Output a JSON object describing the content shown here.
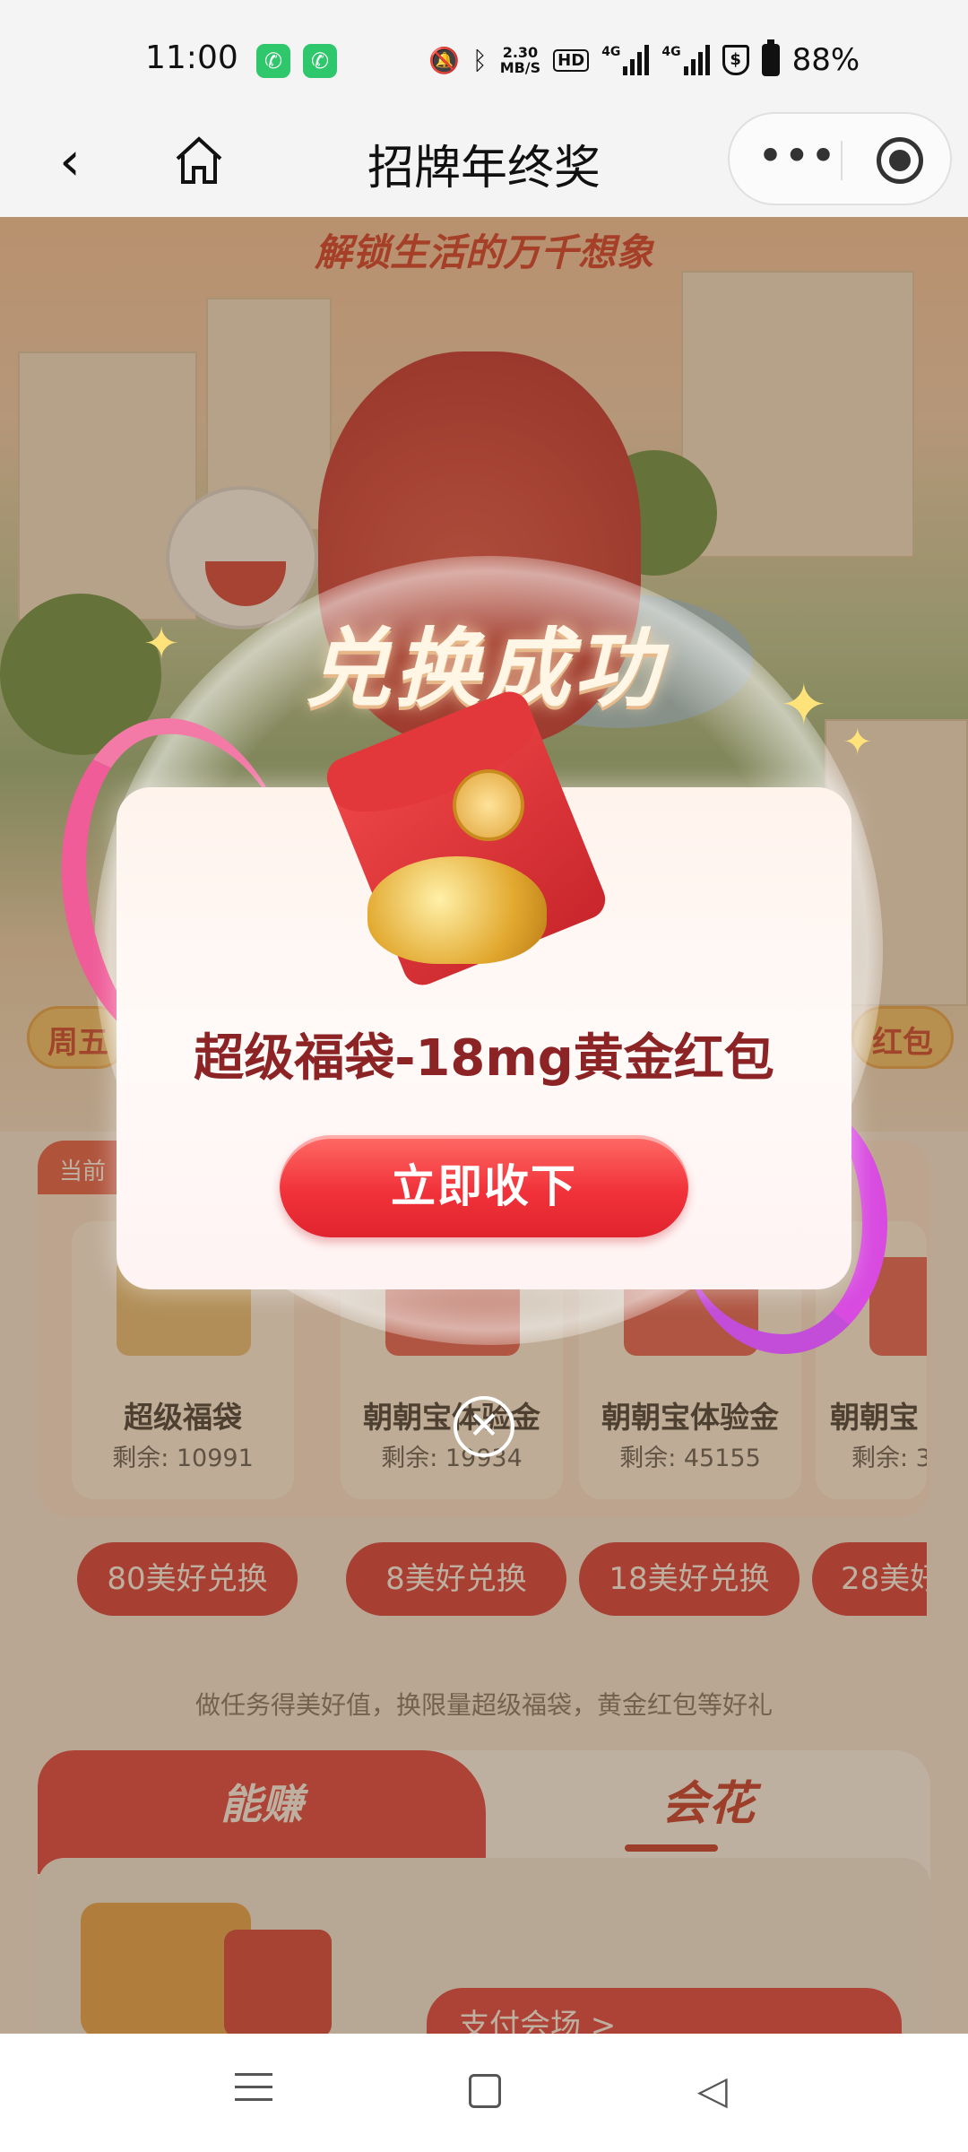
{
  "status_bar": {
    "time": "11:00",
    "call_icons": [
      "phone-icon",
      "phone-icon"
    ],
    "net_speed": "2.30",
    "net_speed_unit": "MB/S",
    "hd_label": "HD",
    "signal_label": "4G",
    "battery_percent": "88%"
  },
  "title_bar": {
    "title": "招牌年终奖",
    "back_icon": "chevron-left-icon",
    "home_icon": "home-icon",
    "more_icon": "more-dots-icon",
    "close_icon": "target-icon"
  },
  "hero": {
    "banner": "解锁生活的万千想象",
    "left_tag": "周五",
    "right_tag": "红包"
  },
  "exchange": {
    "tab_label": "当前",
    "items": [
      {
        "name": "超级福袋",
        "remain": "剩余: 10991",
        "button": "80美好兑换"
      },
      {
        "name": "朝朝宝体验金",
        "remain": "剩余: 19934",
        "button": "8美好兑换"
      },
      {
        "name": "朝朝宝体验金",
        "remain": "剩余: 45155",
        "button": "18美好兑换"
      },
      {
        "name": "朝朝宝",
        "remain": "剩余: 3",
        "button": "28美好"
      }
    ],
    "note": "做任务得美好值，换限量超级福袋，黄金红包等好礼"
  },
  "tabs": {
    "earn": "能赚",
    "spend": "会花",
    "pay_venue": "支付会场 >"
  },
  "modal": {
    "title": "兑换成功",
    "prize_name": "超级福袋-18mg黄金红包",
    "accept_button": "立即收下",
    "close_icon": "close-icon"
  },
  "system_nav": {
    "menu_icon": "menu-icon",
    "home_icon": "square-icon",
    "back_icon": "triangle-back-icon"
  },
  "colors": {
    "accent_red": "#e13a3f",
    "button_red": "#d8323a",
    "prize_text": "#8c2426",
    "status_green": "#2ec76b"
  }
}
